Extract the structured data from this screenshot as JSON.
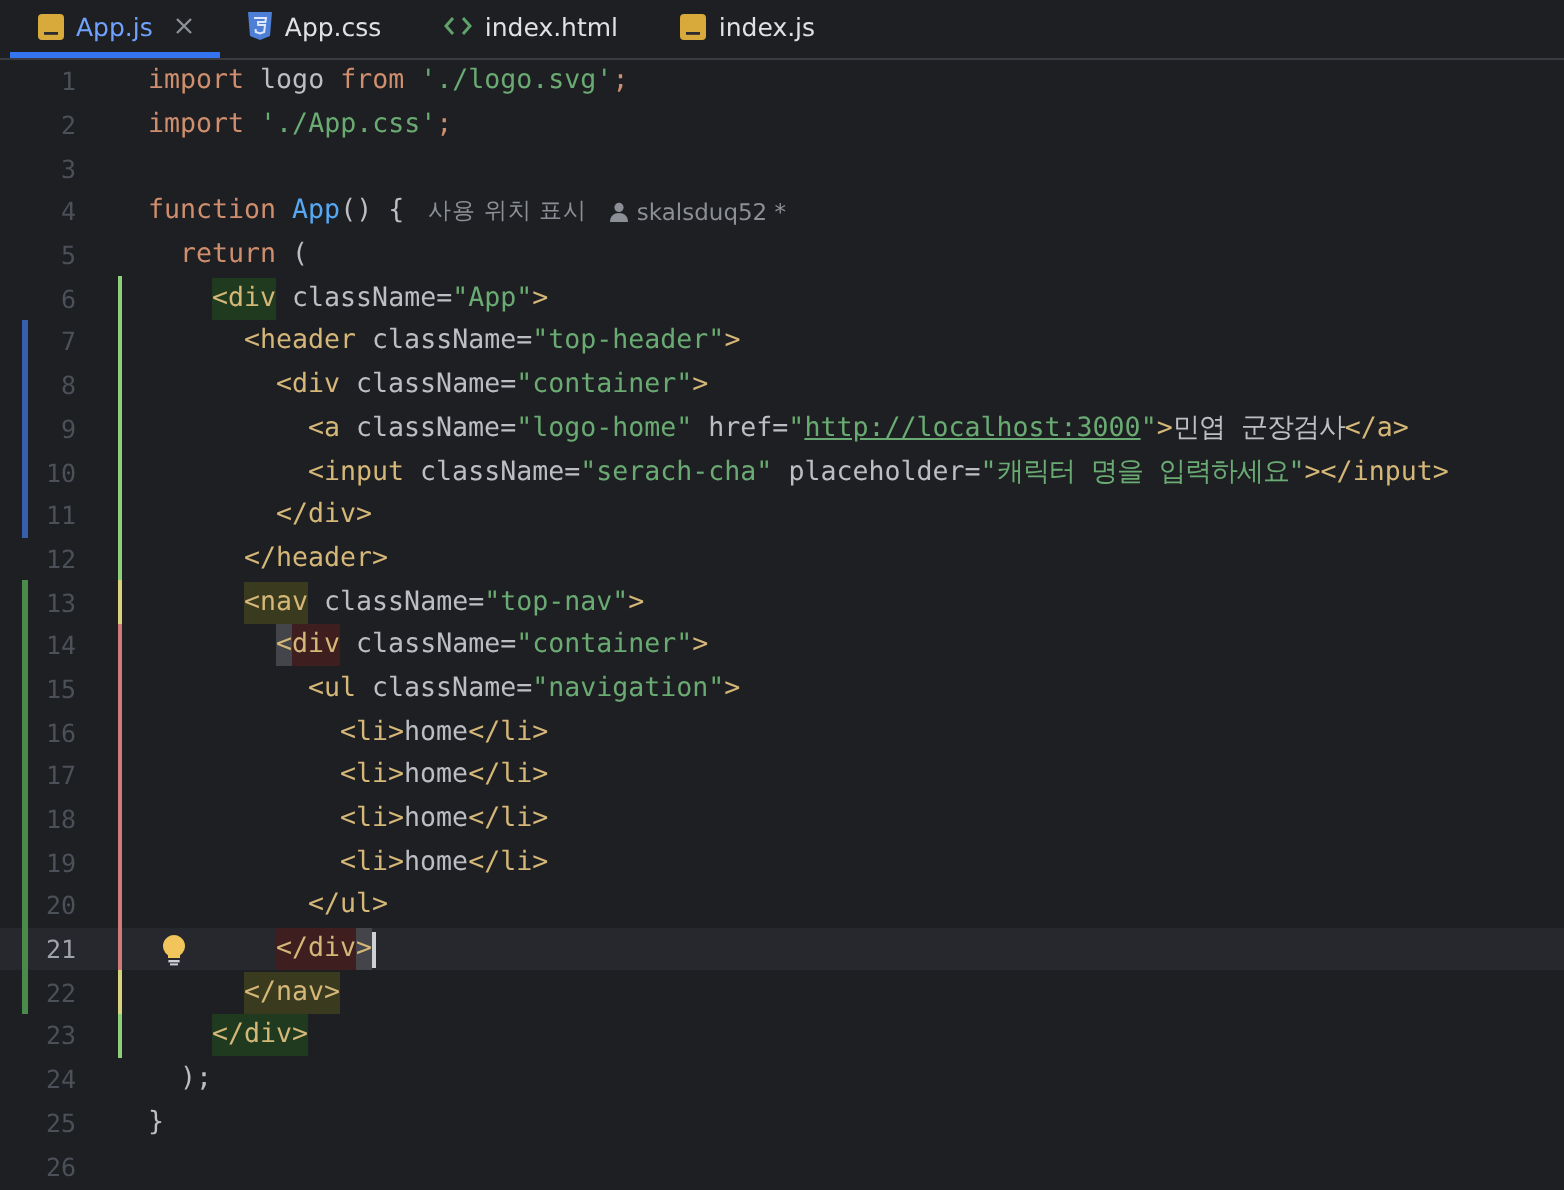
{
  "tabs": [
    {
      "label": "App.js",
      "kind": "js",
      "selected": true,
      "closable": true
    },
    {
      "label": "App.css",
      "kind": "css",
      "selected": false,
      "closable": false
    },
    {
      "label": "index.html",
      "kind": "html",
      "selected": false,
      "closable": false
    },
    {
      "label": "index.js",
      "kind": "js",
      "selected": false,
      "closable": false
    }
  ],
  "lines": [
    {
      "number": "1",
      "current": false,
      "tokens": [
        {
          "kind": "keyword",
          "text": "import"
        },
        {
          "kind": "plain",
          "text": " logo "
        },
        {
          "kind": "keyword",
          "text": "from"
        },
        {
          "kind": "string",
          "text": " './logo.svg'"
        },
        {
          "kind": "keyword",
          "text": ";"
        }
      ]
    },
    {
      "number": "2",
      "current": false,
      "tokens": [
        {
          "kind": "keyword",
          "text": "import"
        },
        {
          "kind": "string",
          "text": " './App.css'"
        },
        {
          "kind": "keyword",
          "text": ";"
        }
      ]
    },
    {
      "number": "3",
      "current": false
    },
    {
      "number": "4",
      "current": false,
      "tokens": [
        {
          "kind": "keyword",
          "text": "function"
        },
        {
          "kind": "function",
          "text": " App"
        },
        {
          "kind": "plain",
          "text": "() {"
        }
      ],
      "hints": [
        {
          "kind": "usages",
          "text": "사용 위치 표시"
        },
        {
          "kind": "author",
          "text": "skalsduq52 *"
        }
      ]
    },
    {
      "number": "5",
      "current": false,
      "tokens": [
        {
          "kind": "keyword",
          "text": "  return"
        },
        {
          "kind": "plain",
          "text": " ("
        }
      ]
    },
    {
      "number": "6",
      "current": false,
      "scope_bar": {
        "color": "#8ed07a"
      },
      "tokens": [
        {
          "kind": "tag",
          "text": "    <div",
          "highlight": {
            "color": "#1f3a1f"
          }
        },
        {
          "kind": "plain",
          "text": " className="
        },
        {
          "kind": "string",
          "text": "\"App\""
        },
        {
          "kind": "tag",
          "text": ">"
        }
      ]
    },
    {
      "number": "7",
      "current": false,
      "change_marker": {
        "color": "#375fad"
      },
      "scope_bar": {
        "color": "#8ed07a"
      },
      "tokens": [
        {
          "kind": "tag",
          "text": "      <header"
        },
        {
          "kind": "plain",
          "text": " className="
        },
        {
          "kind": "string",
          "text": "\"top-header\""
        },
        {
          "kind": "tag",
          "text": ">"
        }
      ]
    },
    {
      "number": "8",
      "current": false,
      "change_marker": {
        "color": "#375fad"
      },
      "scope_bar": {
        "color": "#8ed07a"
      },
      "tokens": [
        {
          "kind": "tag",
          "text": "        <div"
        },
        {
          "kind": "plain",
          "text": " className="
        },
        {
          "kind": "string",
          "text": "\"container\""
        },
        {
          "kind": "tag",
          "text": ">"
        }
      ]
    },
    {
      "number": "9",
      "current": false,
      "change_marker": {
        "color": "#375fad"
      },
      "scope_bar": {
        "color": "#8ed07a"
      },
      "tokens": [
        {
          "kind": "tag",
          "text": "          <a"
        },
        {
          "kind": "plain",
          "text": " className="
        },
        {
          "kind": "string",
          "text": "\"logo-home\""
        },
        {
          "kind": "plain",
          "text": " href="
        },
        {
          "kind": "string",
          "text": "\""
        },
        {
          "kind": "link",
          "text": "http://localhost:3000"
        },
        {
          "kind": "string",
          "text": "\""
        },
        {
          "kind": "tag",
          "text": ">"
        },
        {
          "kind": "plain",
          "text": "민엽 군장검사"
        },
        {
          "kind": "tag",
          "text": "</a>"
        }
      ]
    },
    {
      "number": "10",
      "current": false,
      "change_marker": {
        "color": "#375fad"
      },
      "scope_bar": {
        "color": "#8ed07a"
      },
      "tokens": [
        {
          "kind": "tag",
          "text": "          <input"
        },
        {
          "kind": "plain",
          "text": " className="
        },
        {
          "kind": "string",
          "text": "\"serach-cha\""
        },
        {
          "kind": "plain",
          "text": " placeholder="
        },
        {
          "kind": "string",
          "text": "\"캐릭터 명을 입력하세요\""
        },
        {
          "kind": "tag",
          "text": "></input>"
        }
      ]
    },
    {
      "number": "11",
      "current": false,
      "change_marker": {
        "color": "#375fad"
      },
      "scope_bar": {
        "color": "#8ed07a"
      },
      "tokens": [
        {
          "kind": "tag",
          "text": "        </div>"
        }
      ]
    },
    {
      "number": "12",
      "current": false,
      "scope_bar": {
        "color": "#8ed07a"
      },
      "tokens": [
        {
          "kind": "tag",
          "text": "      </header>"
        }
      ]
    },
    {
      "number": "13",
      "current": false,
      "change_marker": {
        "color": "#4a8a4a"
      },
      "scope_bar": {
        "color": "#d6d37a"
      },
      "tokens": [
        {
          "kind": "tag",
          "text": "      <nav",
          "highlight": {
            "color": "#3a3a1e"
          }
        },
        {
          "kind": "plain",
          "text": " className="
        },
        {
          "kind": "string",
          "text": "\"top-nav\""
        },
        {
          "kind": "tag",
          "text": ">"
        }
      ]
    },
    {
      "number": "14",
      "current": false,
      "change_marker": {
        "color": "#4a8a4a"
      },
      "scope_bar": {
        "color": "#d07a7a"
      },
      "tokens": [
        {
          "kind": "tag",
          "text": "        <",
          "highlight": {
            "color": "#43454a"
          }
        },
        {
          "kind": "tag",
          "text": "div",
          "highlight": {
            "color": "#3e1e1e"
          }
        },
        {
          "kind": "plain",
          "text": " className="
        },
        {
          "kind": "string",
          "text": "\"container\""
        },
        {
          "kind": "tag",
          "text": ">"
        }
      ]
    },
    {
      "number": "15",
      "current": false,
      "change_marker": {
        "color": "#4a8a4a"
      },
      "scope_bar": {
        "color": "#d07a7a"
      },
      "tokens": [
        {
          "kind": "tag",
          "text": "          <ul"
        },
        {
          "kind": "plain",
          "text": " className="
        },
        {
          "kind": "string",
          "text": "\"navigation\""
        },
        {
          "kind": "tag",
          "text": ">"
        }
      ]
    },
    {
      "number": "16",
      "current": false,
      "change_marker": {
        "color": "#4a8a4a"
      },
      "scope_bar": {
        "color": "#d07a7a"
      },
      "tokens": [
        {
          "kind": "tag",
          "text": "            <li>"
        },
        {
          "kind": "plain",
          "text": "home"
        },
        {
          "kind": "tag",
          "text": "</li>"
        }
      ]
    },
    {
      "number": "17",
      "current": false,
      "change_marker": {
        "color": "#4a8a4a"
      },
      "scope_bar": {
        "color": "#d07a7a"
      },
      "tokens": [
        {
          "kind": "tag",
          "text": "            <li>"
        },
        {
          "kind": "plain",
          "text": "home"
        },
        {
          "kind": "tag",
          "text": "</li>"
        }
      ]
    },
    {
      "number": "18",
      "current": false,
      "change_marker": {
        "color": "#4a8a4a"
      },
      "scope_bar": {
        "color": "#d07a7a"
      },
      "tokens": [
        {
          "kind": "tag",
          "text": "            <li>"
        },
        {
          "kind": "plain",
          "text": "home"
        },
        {
          "kind": "tag",
          "text": "</li>"
        }
      ]
    },
    {
      "number": "19",
      "current": false,
      "change_marker": {
        "color": "#4a8a4a"
      },
      "scope_bar": {
        "color": "#d07a7a"
      },
      "tokens": [
        {
          "kind": "tag",
          "text": "            <li>"
        },
        {
          "kind": "plain",
          "text": "home"
        },
        {
          "kind": "tag",
          "text": "</li>"
        }
      ]
    },
    {
      "number": "20",
      "current": false,
      "change_marker": {
        "color": "#4a8a4a"
      },
      "scope_bar": {
        "color": "#d07a7a"
      },
      "tokens": [
        {
          "kind": "tag",
          "text": "          </ul>"
        }
      ]
    },
    {
      "number": "21",
      "current": true,
      "bulb": true,
      "change_marker": {
        "color": "#4a8a4a"
      },
      "scope_bar": {
        "color": "#d07a7a"
      },
      "tokens": [
        {
          "kind": "tag",
          "text": "</div",
          "highlight": {
            "color": "#3e1e1e"
          }
        },
        {
          "kind": "tag",
          "text": ">",
          "highlight": {
            "color": "#43454a"
          }
        }
      ]
    },
    {
      "number": "22",
      "current": false,
      "change_marker": {
        "color": "#4a8a4a"
      },
      "scope_bar": {
        "color": "#d6d37a"
      },
      "tokens": [
        {
          "kind": "tag",
          "text": "      </nav>",
          "highlight": {
            "color": "#3a3a1e"
          }
        }
      ]
    },
    {
      "number": "23",
      "current": false,
      "scope_bar": {
        "color": "#8ed07a"
      },
      "tokens": [
        {
          "kind": "tag",
          "text": "    </div>",
          "highlight": {
            "color": "#1f3a1f"
          }
        }
      ]
    },
    {
      "number": "24",
      "current": false,
      "tokens": [
        {
          "kind": "plain",
          "text": "  );"
        }
      ]
    },
    {
      "number": "25",
      "current": false,
      "tokens": [
        {
          "kind": "plain",
          "text": "}"
        }
      ]
    },
    {
      "number": "26",
      "current": false
    }
  ]
}
